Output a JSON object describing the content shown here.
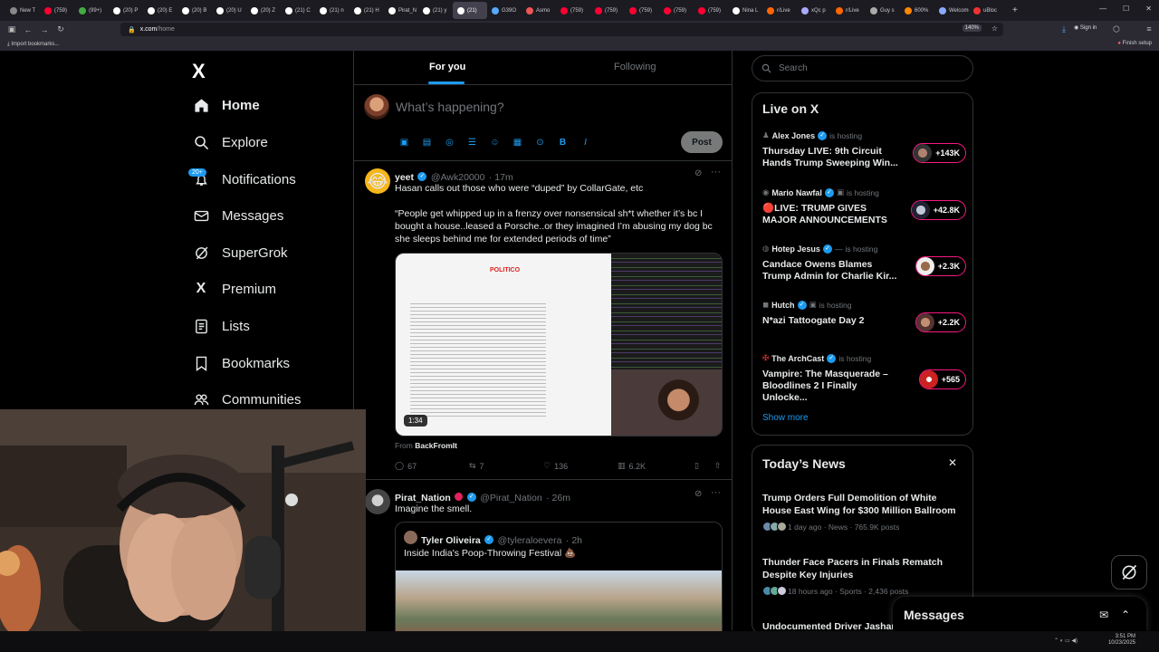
{
  "browser": {
    "tabs": [
      "New T",
      "(759)",
      "(99+)",
      "(20) P",
      "(20) E",
      "(20) B",
      "(20) U",
      "(20) Z",
      "(21) C",
      "(21) n",
      "(21) H",
      "Pirat_N",
      "(21) y",
      "(21)",
      "G39O",
      "Asmo",
      "(759)",
      "(759)",
      "(759)",
      "(759)",
      "(759)",
      "Nina L",
      "r/Live",
      "xQc p",
      "r/Live",
      "Guy s",
      "600%",
      "Welcome",
      "uBloc"
    ],
    "url_domain": "x.com",
    "url_path": "/home",
    "zoom": "140%",
    "signin": "Sign in",
    "bookmark_import": "Import bookmarks...",
    "finish_setup": "Finish setup"
  },
  "nav": {
    "logo": "X",
    "items": [
      {
        "label": "Home",
        "icon": "home-icon"
      },
      {
        "label": "Explore",
        "icon": "search-icon"
      },
      {
        "label": "Notifications",
        "icon": "bell-icon"
      },
      {
        "label": "Messages",
        "icon": "mail-icon"
      },
      {
        "label": "SuperGrok",
        "icon": "grok-icon"
      },
      {
        "label": "Premium",
        "icon": "x-icon"
      },
      {
        "label": "Lists",
        "icon": "list-icon"
      },
      {
        "label": "Bookmarks",
        "icon": "bookmark-icon"
      },
      {
        "label": "Communities",
        "icon": "people-icon"
      }
    ],
    "notif_badge": "20+"
  },
  "feed": {
    "tab_for_you": "For you",
    "tab_following": "Following",
    "compose_placeholder": "What’s happening?",
    "post_button": "Post",
    "tweet1": {
      "name": "yeet",
      "handle": "@Awk20000",
      "time": "· 17m",
      "text1": "Hasan calls out those who were “duped” by CollarGate, etc",
      "text2": "“People get whipped up in a frenzy over nonsensical sh*t whether it’s bc I bought a house..leased a Porsche..or they imagined I’m abusing my dog bc she sleeps behind me for extended periods of time”",
      "video_duration": "1:34",
      "from_label": "From",
      "from_source": "BackFromIt",
      "replies": "67",
      "reposts": "7",
      "likes": "136",
      "views": "6.2K",
      "media_headline": "POLITICO"
    },
    "tweet2": {
      "name": "Pirat_Nation",
      "handle": "@Pirat_Nation",
      "time": "· 26m",
      "text": "Imagine the smell.",
      "quote_name": "Tyler Oliveira",
      "quote_handle": "@tyleraloevera",
      "quote_time": "· 2h",
      "quote_text": "Inside India's Poop-Throwing Festival 💩"
    }
  },
  "right": {
    "search_placeholder": "Search",
    "live_title": "Live on X",
    "is_hosting": "is hosting",
    "live": [
      {
        "host": "Alex Jones",
        "title": "Thursday LIVE: 9th Circuit Hands Trump Sweeping Win...",
        "count": "+143K"
      },
      {
        "host": "Mario Nawfal",
        "title": "🔴LIVE: TRUMP GIVES MAJOR ANNOUNCEMENTS",
        "count": "+42.8K"
      },
      {
        "host": "Hotep Jesus",
        "title": "Candace Owens Blames Trump Admin for Charlie Kir...",
        "count": "+2.3K"
      },
      {
        "host": "Hutch",
        "title": "N*azi Tattoogate Day 2",
        "count": "+2.2K"
      },
      {
        "host": "The ArchCast",
        "title": "Vampire: The Masquerade – Bloodlines 2 I Finally Unlocke...",
        "count": "+565"
      }
    ],
    "show_more": "Show more",
    "news_title": "Today’s News",
    "news": [
      {
        "title": "Trump Orders Full Demolition of White House East Wing for $300 Million Ballroom",
        "meta": "1 day ago · News · 765.9K posts"
      },
      {
        "title": "Thunder Face Pacers in Finals Rematch Despite Key Injuries",
        "meta": "18 hours ago · Sports · 2,436 posts"
      },
      {
        "title": "Undocumented Driver Jashar...",
        "meta": ""
      }
    ],
    "messages_label": "Messages"
  },
  "taskbar": {
    "time": "3:51 PM",
    "date": "10/23/2025"
  },
  "colors": {
    "accent": "#1d9bf0",
    "live_ring": "#f91880",
    "background": "#000000"
  }
}
